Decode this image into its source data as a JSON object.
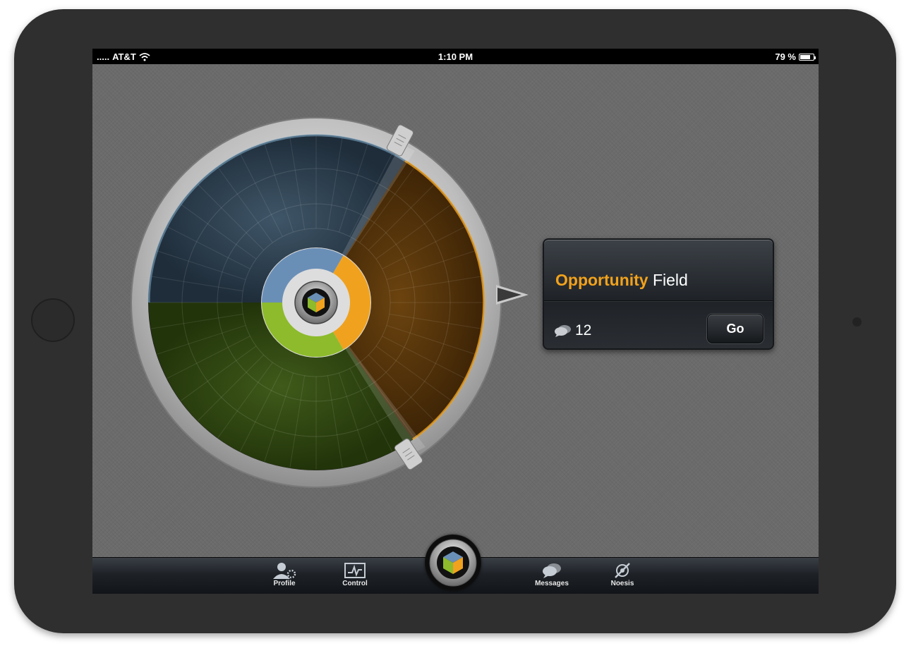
{
  "status_bar": {
    "carrier": "AT&T",
    "time": "1:10 PM",
    "battery_percent": "79 %",
    "battery_level": 0.79
  },
  "dial": {
    "segments": [
      {
        "name": "blue",
        "color": "#6a8fb7"
      },
      {
        "name": "orange",
        "color": "#f0a21e"
      },
      {
        "name": "green",
        "color": "#8dbb2b"
      }
    ]
  },
  "opportunity_card": {
    "title_highlight": "Opportunity",
    "title_rest": "Field",
    "comment_count": "12",
    "go_label": "Go",
    "highlight_color": "#f2a21b"
  },
  "tabbar": {
    "items": [
      {
        "label": "Profile",
        "icon": "profile-icon"
      },
      {
        "label": "Control",
        "icon": "control-icon"
      },
      {
        "label": "Messages",
        "icon": "messages-icon"
      },
      {
        "label": "Noesis",
        "icon": "noesis-icon"
      }
    ],
    "center_icon": "cube-icon"
  }
}
